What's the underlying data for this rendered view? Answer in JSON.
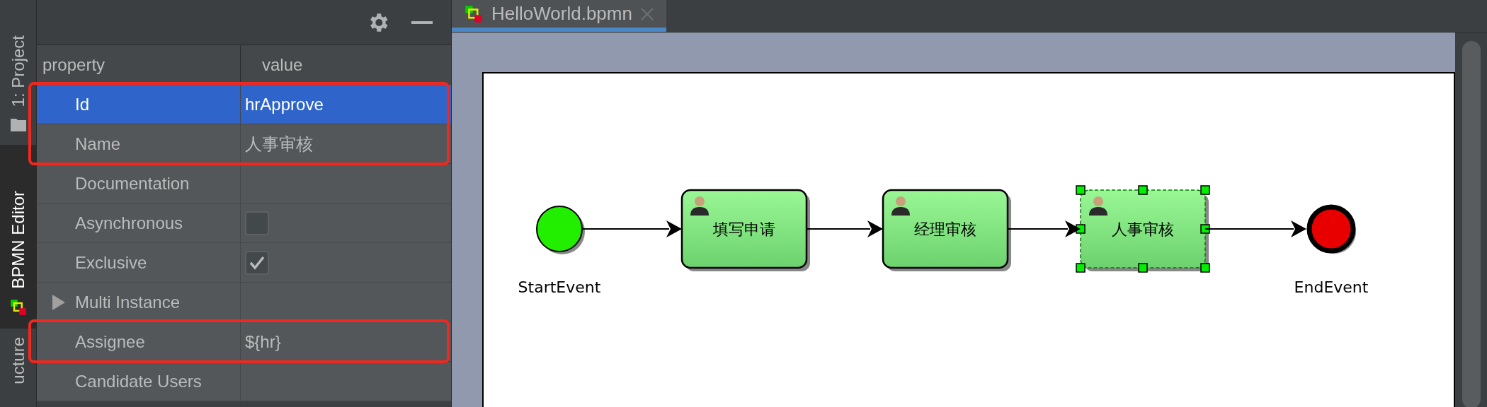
{
  "tool_strip": {
    "tabs": [
      {
        "label": "1: Project",
        "selected": false
      },
      {
        "label": "BPMN Editor",
        "selected": true
      },
      {
        "label": "ucture",
        "selected": false
      }
    ]
  },
  "properties": {
    "columns": [
      "property",
      "value"
    ],
    "rows": [
      {
        "property": "Id",
        "kind": "text",
        "value": "hrApprove",
        "selected": true,
        "outlined": true
      },
      {
        "property": "Name",
        "kind": "text",
        "value": "人事审核",
        "selected": false,
        "outlined": true
      },
      {
        "property": "Documentation",
        "kind": "text",
        "selected": false,
        "outlined": false
      },
      {
        "property": "Asynchronous",
        "kind": "checkbox",
        "checked": false,
        "selected": false,
        "outlined": false
      },
      {
        "property": "Exclusive",
        "kind": "checkbox",
        "checked": true,
        "selected": false,
        "outlined": false
      },
      {
        "property": "Multi Instance",
        "kind": "group",
        "expanded": false,
        "selected": false,
        "outlined": false
      },
      {
        "property": "Assignee",
        "kind": "text",
        "value": "${hr}",
        "selected": false,
        "outlined": true
      },
      {
        "property": "Candidate Users",
        "kind": "text",
        "selected": false,
        "outlined": false
      }
    ]
  },
  "editor": {
    "tabs": [
      {
        "label": "HelloWorld.bpmn",
        "selected": true
      }
    ],
    "nodes": [
      {
        "kind": "start_event",
        "label": "StartEvent",
        "selected": false
      },
      {
        "kind": "user_task",
        "label": "填写申请",
        "selected": false
      },
      {
        "kind": "user_task",
        "label": "经理审核",
        "selected": false
      },
      {
        "kind": "user_task",
        "label": "人事审核",
        "selected": true
      },
      {
        "kind": "end_event",
        "label": "EndEvent",
        "selected": false
      }
    ]
  }
}
